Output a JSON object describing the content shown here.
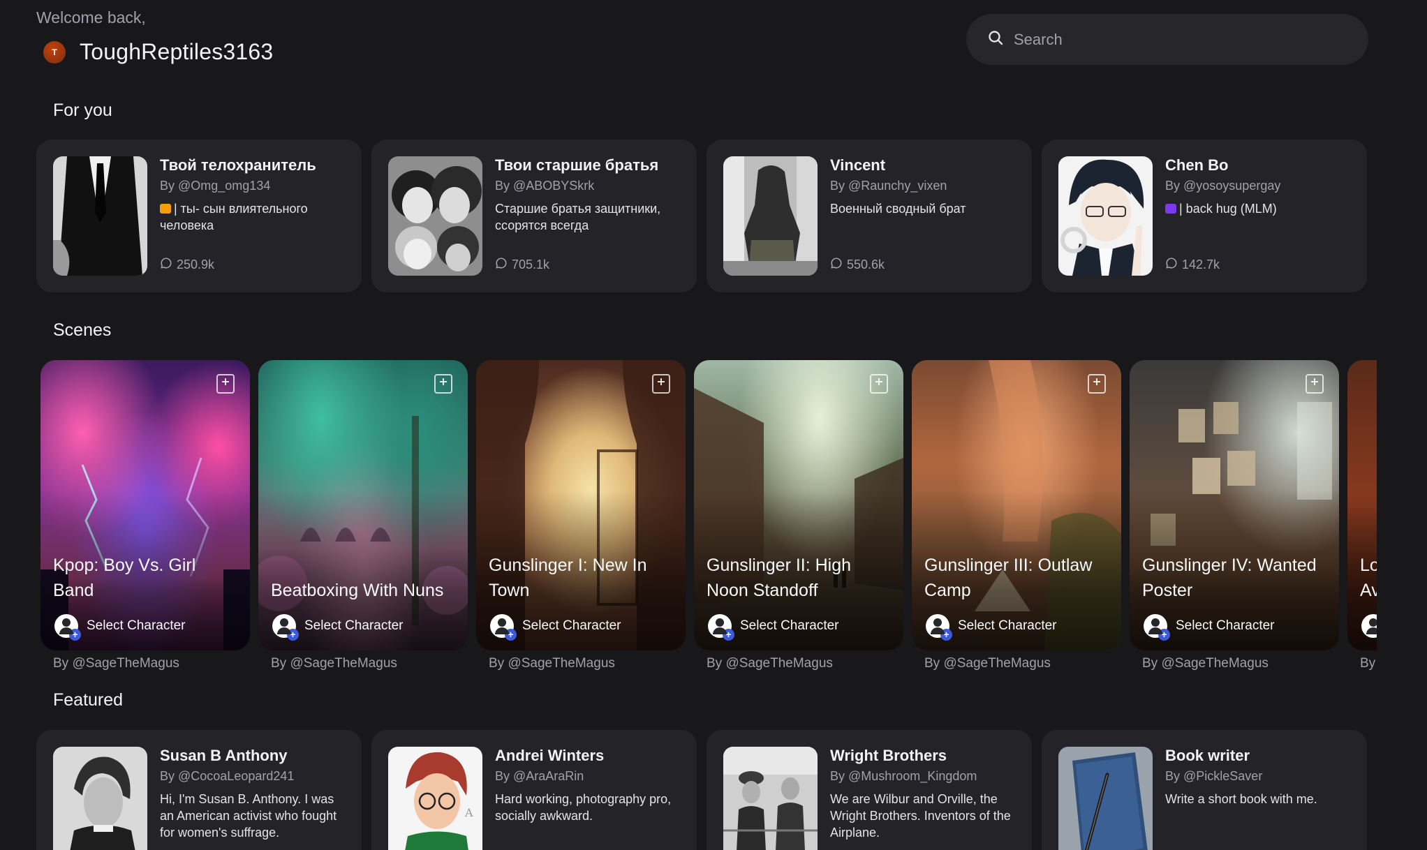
{
  "header": {
    "welcome": "Welcome back,",
    "avatar_initial": "T",
    "username": "ToughReptiles3163"
  },
  "search": {
    "placeholder": "Search"
  },
  "sections": {
    "for_you": "For you",
    "scenes": "Scenes",
    "featured": "Featured"
  },
  "for_you": [
    {
      "name": "Твой телохранитель",
      "author": "By @Omg_omg134",
      "emoji": "🎫",
      "emoji_color": "#f59e0b",
      "desc": "| ты- сын влиятельного человека",
      "count": "250.9k"
    },
    {
      "name": "Твои старшие братья",
      "author": "By @ABOBYSkrk",
      "emoji": "",
      "desc": "Старшие братья защитники, ссорятся всегда",
      "count": "705.1k"
    },
    {
      "name": "Vincent",
      "author": "By @Raunchy_vixen",
      "emoji": "",
      "desc": "Военный сводный брат",
      "count": "550.6k"
    },
    {
      "name": "Chen Bo",
      "author": "By @yosoysupergay",
      "emoji": "🟪",
      "emoji_color": "#7c3aed",
      "desc": "| back hug (MLM)",
      "count": "142.7k"
    }
  ],
  "scenes": [
    {
      "title": "Kpop: Boy Vs. Girl Band",
      "select_label": "Select Character",
      "author": "By @SageTheMagus"
    },
    {
      "title": "Beatboxing With Nuns",
      "select_label": "Select Character",
      "author": "By @SageTheMagus"
    },
    {
      "title": "Gunslinger I: New In Town",
      "select_label": "Select Character",
      "author": "By @SageTheMagus"
    },
    {
      "title": "Gunslinger II: High Noon Standoff",
      "select_label": "Select Character",
      "author": "By @SageTheMagus"
    },
    {
      "title": "Gunslinger III: Outlaw Camp",
      "select_label": "Select Character",
      "author": "By @SageTheMagus"
    },
    {
      "title": "Gunslinger IV: Wanted Poster",
      "select_label": "Select Character",
      "author": "By @SageTheMagus"
    },
    {
      "title": "Lo Av",
      "select_label": "",
      "author": "By"
    }
  ],
  "featured": [
    {
      "name": "Susan B Anthony",
      "author": "By @CocoaLeopard241",
      "desc": "Hi, I'm Susan B. Anthony. I was an American activist who fought for women's suffrage."
    },
    {
      "name": "Andrei Winters",
      "author": "By @AraAraRin",
      "desc": "Hard working, photography pro, socially awkward."
    },
    {
      "name": "Wright Brothers",
      "author": "By @Mushroom_Kingdom",
      "desc": "We are Wilbur and Orville, the Wright Brothers. Inventors of the Airplane."
    },
    {
      "name": "Book writer",
      "author": "By @PickleSaver",
      "desc": "Write a short book with me."
    }
  ]
}
